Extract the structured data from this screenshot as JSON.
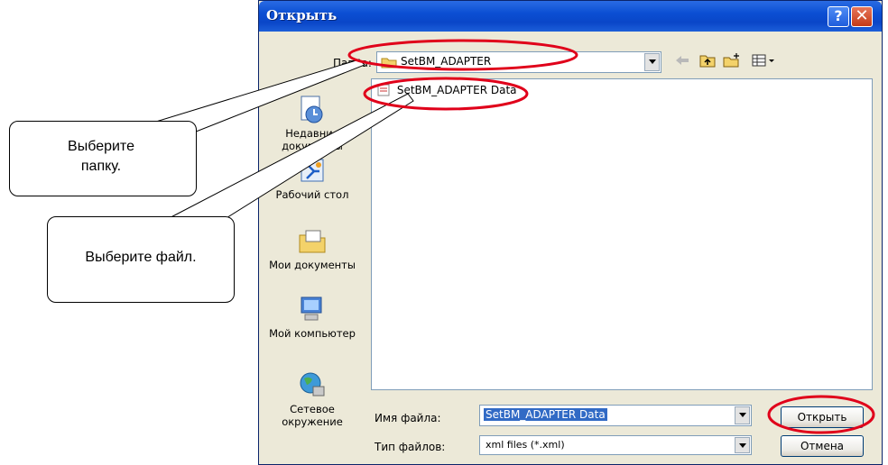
{
  "dialog": {
    "title": "Открыть",
    "look_in_label": "Папка:",
    "look_in_value": "SetBM_ADAPTER",
    "places": [
      {
        "label": "Недавние документы",
        "icon": "recent-documents-icon"
      },
      {
        "label": "Рабочий стол",
        "icon": "desktop-icon"
      },
      {
        "label": "Мои документы",
        "icon": "my-documents-icon"
      },
      {
        "label": "Мой компьютер",
        "icon": "my-computer-icon"
      },
      {
        "label": "Сетевое окружение",
        "icon": "network-icon"
      }
    ],
    "files": [
      {
        "name": "SetBM_ADAPTER Data",
        "icon": "xml-file-icon"
      }
    ],
    "filename_label": "Имя файла:",
    "filename_value": "SetBM_ADAPTER Data",
    "filetype_label": "Тип файлов:",
    "filetype_value": "xml files (*.xml)",
    "open_button": "Открыть",
    "cancel_button": "Отмена",
    "help_button": "?",
    "close_button": "✕"
  },
  "callouts": {
    "folder": "Выберите папку.",
    "file": "Выберите файл."
  },
  "colors": {
    "title_bar": "#0b4fd3",
    "window_bg": "#ece9d8",
    "highlight_ellipse": "#e0001a",
    "selection": "#316ac5"
  }
}
